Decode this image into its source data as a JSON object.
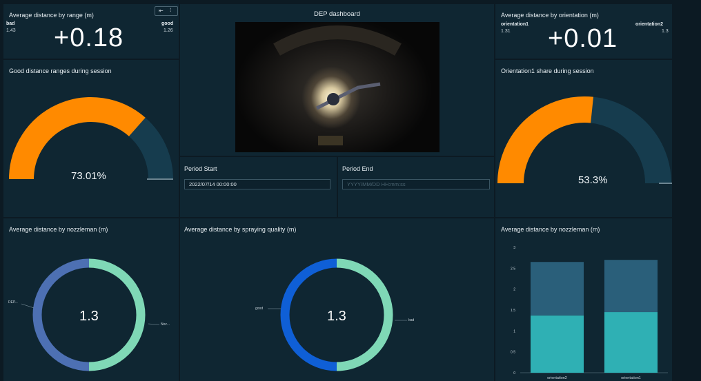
{
  "dashboard": {
    "title": "DEP dashboard"
  },
  "kpi_range": {
    "title": "Average distance by range (m)",
    "left_label": "bad",
    "left_value": "1.43",
    "right_label": "good",
    "right_value": "1.26",
    "delta": "+0.18",
    "toolbar_icons": [
      "collapse-icon",
      "more-options-icon"
    ]
  },
  "kpi_orientation": {
    "title": "Average distance by orientation (m)",
    "left_label": "orientation1",
    "left_value": "1.31",
    "right_label": "orientation2",
    "right_value": "1.3",
    "delta": "+0.01"
  },
  "gauge_good": {
    "title": "Good distance ranges during session",
    "percent_label": "73.01%",
    "fraction": 0.7301,
    "colors": {
      "fill": "#ff8a00",
      "track": "#163c4e"
    }
  },
  "gauge_orientation": {
    "title": "Orientation1 share during session",
    "percent_label": "53.3%",
    "fraction": 0.533,
    "colors": {
      "fill": "#ff8a00",
      "track": "#163c4e"
    }
  },
  "period": {
    "start_label": "Period Start",
    "start_value": "2022/07/14 00:00:00",
    "end_label": "Period End",
    "end_placeholder": "YYYY/MM/DD HH:mm:ss"
  },
  "donut_nozzleman": {
    "title": "Average distance by nozzleman (m)",
    "center": "1.3",
    "left_legend": "DEP...",
    "right_legend": "Noz...",
    "segments": [
      {
        "share": 0.5,
        "color": "#7fd8b6"
      },
      {
        "share": 0.5,
        "color": "#4d70b3"
      }
    ]
  },
  "donut_quality": {
    "title": "Average distance by spraying quality (m)",
    "center": "1.3",
    "left_legend": "good",
    "right_legend": "bad",
    "segments": [
      {
        "share": 0.5,
        "color": "#7fd8b6"
      },
      {
        "share": 0.5,
        "color": "#0f5fd6"
      }
    ]
  },
  "bar_panel": {
    "title": "Average distance by nozzleman (m)"
  },
  "chart_data": {
    "type": "bar",
    "stacked": true,
    "categories": [
      "orientation2",
      "orientation1"
    ],
    "series": [
      {
        "values": [
          1.37,
          1.45
        ],
        "color": "#2fb0b4"
      },
      {
        "values": [
          1.28,
          1.25
        ],
        "color": "#2a5f7a"
      }
    ],
    "ylim": [
      0,
      3
    ],
    "yticks": [
      "0",
      "0.5",
      "1",
      "1.5",
      "2",
      "2.5",
      "3"
    ],
    "title": "Average distance by nozzleman (m)"
  }
}
